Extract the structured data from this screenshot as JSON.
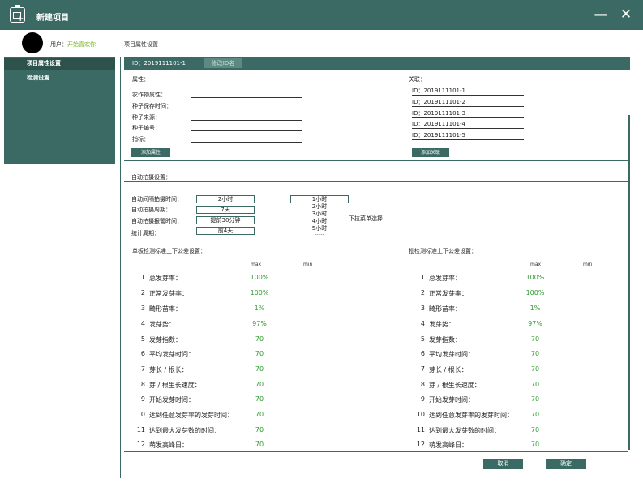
{
  "window": {
    "title": "新建项目",
    "minimize_glyph": "—",
    "close_glyph": "✕"
  },
  "user": {
    "label": "用户：",
    "name": "开始喜欢你"
  },
  "breadcrumb": "项目属性设置",
  "sidebar": {
    "items": [
      {
        "label": "项目属性设置",
        "active": true
      },
      {
        "label": "检测设置",
        "active": false
      }
    ]
  },
  "idbar": {
    "id": "ID：2019111101-1",
    "rename_label": "修改ID名"
  },
  "attributes": {
    "title": "属性：",
    "fields": [
      {
        "label": "农作物属性："
      },
      {
        "label": "种子保存时间："
      },
      {
        "label": "种子来源："
      },
      {
        "label": "种子编号："
      },
      {
        "label": "指标："
      }
    ],
    "add_label": "添加属性"
  },
  "relations": {
    "title": "关联：",
    "items": [
      "ID：2019111101-1",
      "ID：2019111101-2",
      "ID：2019111101-3",
      "ID：2019111101-4",
      "ID：2019111101-5"
    ],
    "add_label": "添加关联"
  },
  "auto_capture": {
    "title": "自动拍摄设置：",
    "rows": [
      {
        "label": "自动间隔拍摄时间：",
        "value": "2小时"
      },
      {
        "label": "自动拍摄周期：",
        "value": "7天"
      },
      {
        "label": "自动拍摄报警时间：",
        "value": "提前30分钟"
      },
      {
        "label": "统计周期：",
        "value": "前4天"
      }
    ],
    "dropdown_options": [
      "1小时",
      "2小时",
      "3小时",
      "4小时",
      "5小时",
      "......"
    ],
    "dropdown_note": "下拉菜单选择"
  },
  "single_tolerance": {
    "title": "单板检测标准上下公差设置：",
    "col_max": "max",
    "col_min": "min",
    "rows": [
      {
        "num": "1",
        "name": "总发芽率：",
        "max": "100%"
      },
      {
        "num": "2",
        "name": "正常发芽率：",
        "max": "100%"
      },
      {
        "num": "3",
        "name": "畸形苗率：",
        "max": "1%"
      },
      {
        "num": "4",
        "name": "发芽势：",
        "max": "97%"
      },
      {
        "num": "5",
        "name": "发芽指数：",
        "max": "70"
      },
      {
        "num": "6",
        "name": "平均发芽时间：",
        "max": "70"
      },
      {
        "num": "7",
        "name": "芽长 / 根长：",
        "max": "70"
      },
      {
        "num": "8",
        "name": "芽 / 根生长速度：",
        "max": "70"
      },
      {
        "num": "9",
        "name": "开始发芽时间：",
        "max": "70"
      },
      {
        "num": "10",
        "name": "达到任意发芽率的发芽时间：",
        "max": "70"
      },
      {
        "num": "11",
        "name": "达到最大发芽数的时间：",
        "max": "70"
      },
      {
        "num": "12",
        "name": "萌发高峰日：",
        "max": "70"
      }
    ]
  },
  "batch_tolerance": {
    "title": "批检测标准上下公差设置：",
    "col_max": "max",
    "col_min": "min",
    "rows": [
      {
        "num": "1",
        "name": "总发芽率：",
        "max": "100%"
      },
      {
        "num": "2",
        "name": "正常发芽率：",
        "max": "100%"
      },
      {
        "num": "3",
        "name": "畸形苗率：",
        "max": "1%"
      },
      {
        "num": "4",
        "name": "发芽势：",
        "max": "97%"
      },
      {
        "num": "5",
        "name": "发芽指数：",
        "max": "70"
      },
      {
        "num": "6",
        "name": "平均发芽时间：",
        "max": "70"
      },
      {
        "num": "7",
        "name": "芽长 / 根长：",
        "max": "70"
      },
      {
        "num": "8",
        "name": "芽 / 根生长速度：",
        "max": "70"
      },
      {
        "num": "9",
        "name": "开始发芽时间：",
        "max": "70"
      },
      {
        "num": "10",
        "name": "达到任意发芽率的发芽时间：",
        "max": "70"
      },
      {
        "num": "11",
        "name": "达到最大发芽数的时间：",
        "max": "70"
      },
      {
        "num": "12",
        "name": "萌发高峰日：",
        "max": "70"
      }
    ]
  },
  "footer": {
    "cancel_label": "取消",
    "ok_label": "确定"
  },
  "colors": {
    "primary": "#3a6a63",
    "value_green": "#2e9a2e",
    "username_green": "#7ab520"
  }
}
